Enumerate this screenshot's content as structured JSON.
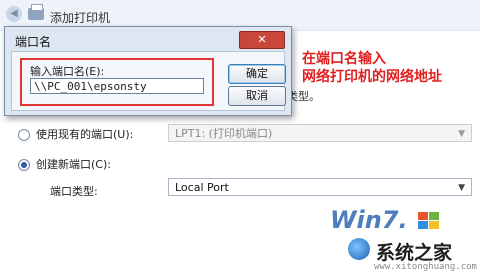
{
  "window": {
    "title": "添加打印机"
  },
  "dialog": {
    "title": "端口名",
    "input_label": "输入端口名(E):",
    "input_value": "\\\\PC_001\\epsonsty",
    "ok_label": "确定",
    "cancel_label": "取消"
  },
  "annotation": {
    "line1": "在端口名输入",
    "line2": "网络打印机的网络地址"
  },
  "background": {
    "port_type_tail": "类型。",
    "use_existing_label": "使用现有的端口(U):",
    "existing_port_value": "LPT1: (打印机端口)",
    "create_new_label": "创建新端口(C):",
    "port_type_label": "端口类型:",
    "port_type_value": "Local Port"
  },
  "watermark": {
    "logo_text": "Win7.",
    "site_name": "系统之家",
    "site_url": "www.xitonghuang.com"
  },
  "colors": {
    "annotation": "#e02020",
    "highlight": "#e23434",
    "dialog_bg": "#dde6f1"
  }
}
